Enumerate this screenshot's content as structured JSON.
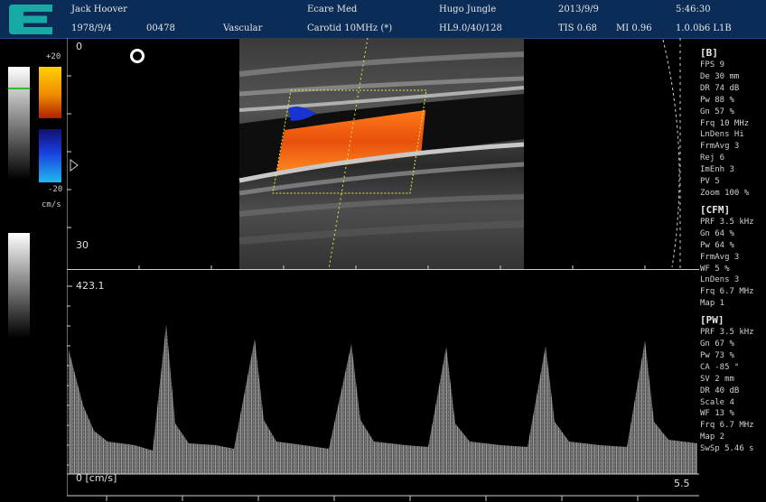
{
  "header": {
    "patient_name": "Jack Hoover",
    "birth_date": "1978/9/4",
    "patient_id": "00478",
    "exam_type": "Vascular",
    "hospital": "Ecare Med",
    "preset": "Carotid 10MHz (*)",
    "operator": "Hugo Jungle",
    "probe_info": "HL9.0/40/128",
    "date": "2013/9/9",
    "tis": "TIS 0.68",
    "mi": "MI 0.96",
    "time": "5:46:30",
    "version": "1.0.0b6 L1B"
  },
  "colors": {
    "header_bg": "#0b2c57",
    "logo": "#17a9a4",
    "flow_red": "#e65a10",
    "flow_blue": "#1534d0",
    "sample_box": "#e8e84a"
  },
  "color_scale": {
    "top": "+20",
    "bottom": "-20",
    "unit": "cm/s"
  },
  "bmode": {
    "depth_top": "0",
    "depth_bottom": "30"
  },
  "doppler": {
    "max_label": "423.1",
    "zero_label": "0 [cm/s]",
    "time_label": "5.5"
  },
  "params": {
    "b": {
      "title": "[B]",
      "rows": [
        "FPS 9",
        "De 30 mm",
        "DR 74 dB",
        "Pw 88 %",
        "Gn 57 %",
        "Frq 10 MHz",
        "LnDens Hi",
        "FrmAvg 3",
        "Rej 6",
        "ImEnh 3",
        "PV 5",
        "Zoom 100 %"
      ]
    },
    "cfm": {
      "title": "[CFM]",
      "rows": [
        "PRF 3.5 kHz",
        "Gn 64 %",
        "Pw 64 %",
        "FrmAvg 3",
        "WF 5 %",
        "LnDens 3",
        "Frq 6.7 MHz",
        "Map 1"
      ]
    },
    "pw": {
      "title": "[PW]",
      "rows": [
        "PRF 3.5 kHz",
        "Gn 67 %",
        "Pw 73 %",
        "CA -85 °",
        "SV 2 mm",
        "DR 40 dB",
        "Scale 4",
        "WF 13 %",
        "Frq 6.7 MHz",
        "Map 2",
        "SwSp 5.46 s"
      ]
    }
  }
}
